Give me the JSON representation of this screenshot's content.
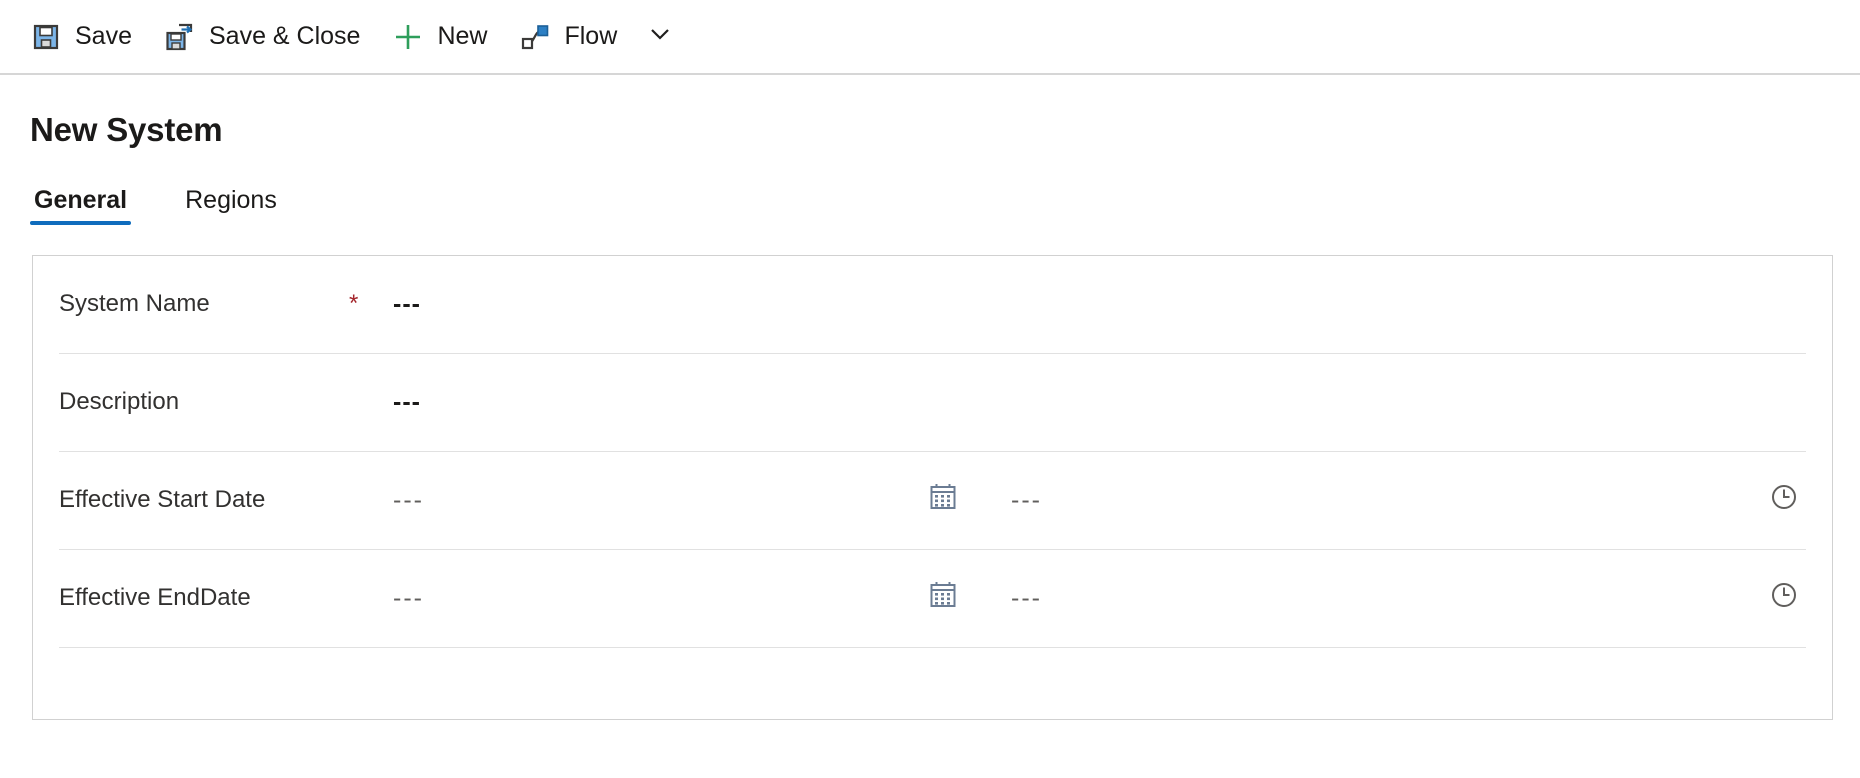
{
  "command_bar": {
    "buttons": [
      {
        "id": "save",
        "label": "Save",
        "icon": "save-floppy-icon"
      },
      {
        "id": "save-close",
        "label": "Save & Close",
        "icon": "save-and-close-icon"
      },
      {
        "id": "new",
        "label": "New",
        "icon": "plus-icon"
      },
      {
        "id": "flow",
        "label": "Flow",
        "icon": "flow-icon"
      }
    ],
    "overflow_icon": "chevron-down-icon"
  },
  "page": {
    "title": "New System"
  },
  "tabs": [
    {
      "id": "general",
      "label": "General",
      "active": true
    },
    {
      "id": "regions",
      "label": "Regions",
      "active": false
    }
  ],
  "form": {
    "rows": [
      {
        "id": "system-name",
        "label": "System Name",
        "required": true,
        "required_mark": "*",
        "value": "---",
        "type": "text"
      },
      {
        "id": "description",
        "label": "Description",
        "required": false,
        "required_mark": "",
        "value": "---",
        "type": "text"
      },
      {
        "id": "effective-start-date",
        "label": "Effective Start Date",
        "required": false,
        "required_mark": "",
        "value": "---",
        "time_value": "---",
        "type": "datetime",
        "date_icon": "calendar-icon",
        "time_icon": "clock-icon"
      },
      {
        "id": "effective-end-date",
        "label": "Effective EndDate",
        "required": false,
        "required_mark": "",
        "value": "---",
        "time_value": "---",
        "type": "datetime",
        "date_icon": "calendar-icon",
        "time_icon": "clock-icon"
      }
    ]
  },
  "colors": {
    "accent_blue": "#0f6cbd",
    "icon_blue": "#5b9bd5",
    "icon_dark": "#3b3a39",
    "new_green": "#2e9e5b",
    "required_red": "#a4262c",
    "border_gray": "#d1d1d1",
    "text_primary": "#1b1a19"
  }
}
